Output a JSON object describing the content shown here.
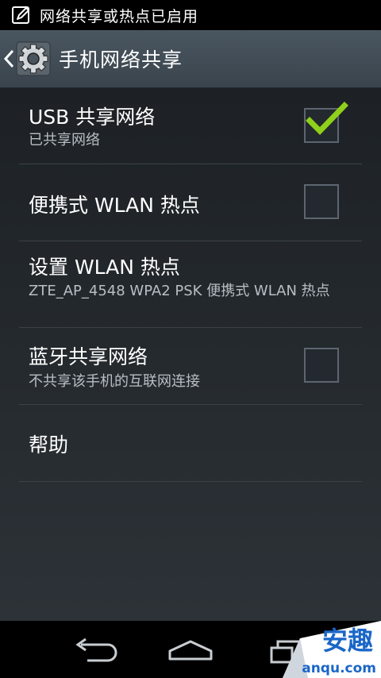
{
  "status_bar": {
    "notification_icon": "edit-note-icon",
    "text": "网络共享或热点已启用"
  },
  "action_bar": {
    "up_icon": "chevron-left-icon",
    "app_icon": "gear-icon",
    "title": "手机网络共享"
  },
  "preferences": [
    {
      "title": "USB 共享网络",
      "summary": "已共享网络",
      "checkbox": true,
      "checked": true
    },
    {
      "title": "便携式 WLAN 热点",
      "summary": "",
      "checkbox": true,
      "checked": false
    },
    {
      "title": "设置 WLAN 热点",
      "summary": "ZTE_AP_4548 WPA2 PSK 便携式 WLAN 热点",
      "checkbox": false
    },
    {
      "title": "蓝牙共享网络",
      "summary": "不共享该手机的互联网连接",
      "checkbox": true,
      "checked": false
    },
    {
      "title": "帮助",
      "summary": "",
      "checkbox": false
    }
  ],
  "nav_bar": {
    "back_icon": "back-arrow-icon",
    "home_icon": "home-icon",
    "recents_icon": "recent-apps-icon"
  },
  "watermark": {
    "big": "安趣",
    "small": "anqu.com"
  },
  "colors": {
    "check_accent": "#8fd01a",
    "action_bar": "#434e57"
  }
}
